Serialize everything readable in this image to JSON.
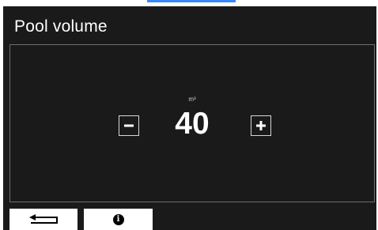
{
  "screen": {
    "title": "Pool volume"
  },
  "volume": {
    "unit": "m³",
    "value": "40"
  },
  "controls": {
    "decrease_icon": "minus-icon",
    "increase_icon": "plus-icon"
  },
  "softkeys": {
    "back_icon": "return-arrow-icon",
    "info_icon": "info-icon",
    "info_glyph": "i"
  },
  "colors": {
    "background": "#1a1a1a",
    "panel_border": "#6e6e6e",
    "text": "#ffffff",
    "softkey": "#ffffff",
    "accent": "#3a86ff"
  }
}
